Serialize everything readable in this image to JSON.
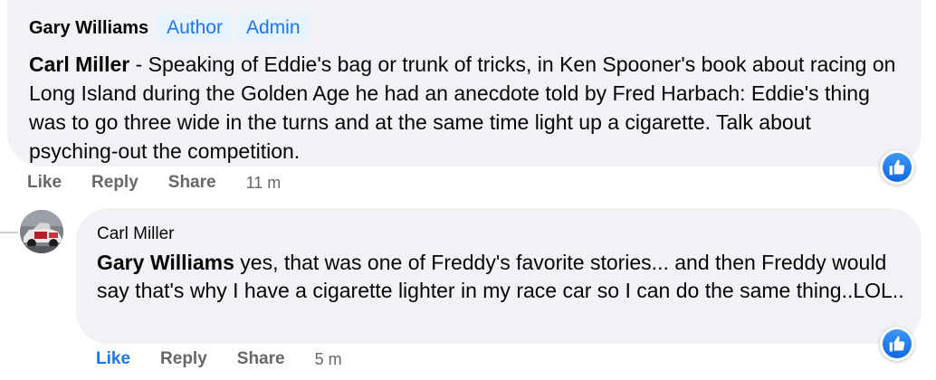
{
  "comment": {
    "author": "Gary Williams",
    "badges": [
      "Author",
      "Admin"
    ],
    "mention": "Carl Miller",
    "text": " - Speaking of Eddie's bag or trunk of tricks, in Ken Spooner's book about racing on Long Island during the Golden Age he had an anecdote told by Fred Harbach: Eddie's thing was to go three wide in the turns and at the same time light up a cigarette. Talk about psyching-out the competition.",
    "actions": {
      "like": "Like",
      "reply": "Reply",
      "share": "Share",
      "time": "11 m"
    },
    "reaction_icon": "thumbs-up-icon"
  },
  "reply": {
    "author": "Carl Miller",
    "mention": "Gary Williams",
    "text": " yes, that was one of Freddy's favorite stories... and then Freddy would say that's why I have a cigarette lighter in my race car so I can do the same thing..LOL..",
    "actions": {
      "like": "Like",
      "reply": "Reply",
      "share": "Share",
      "time": "5 m"
    },
    "liked": true,
    "reaction_icon": "thumbs-up-icon"
  },
  "colors": {
    "bubble": "#f0f2f5",
    "accent": "#1877f2",
    "muted": "#65676b",
    "badge_bg": "#e7f3ff"
  }
}
